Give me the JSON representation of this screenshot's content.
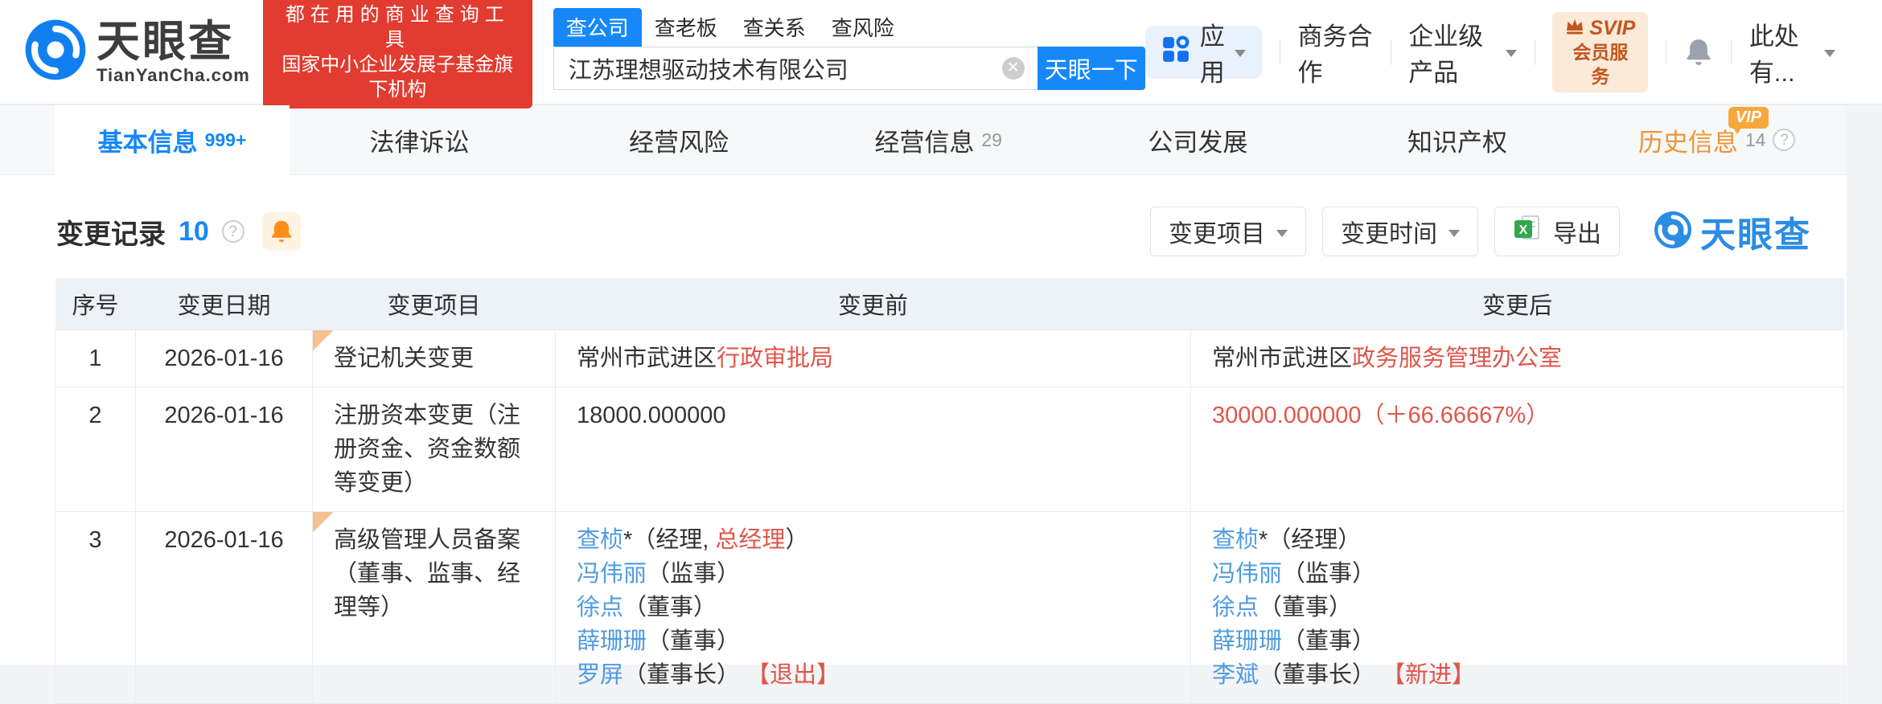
{
  "colors": {
    "blue": "#1688fa",
    "link": "#4f9be0",
    "red": "#e0564a",
    "orange": "#ee9436"
  },
  "brand": {
    "logo_text": "天眼查",
    "logo_domain": "TianYanCha.com",
    "slogan1": "都在用的商业查询工具",
    "slogan2": "国家中小企业发展子基金旗下机构"
  },
  "search": {
    "tabs": [
      {
        "label": "查公司",
        "active": true
      },
      {
        "label": "查老板",
        "active": false
      },
      {
        "label": "查关系",
        "active": false
      },
      {
        "label": "查风险",
        "active": false
      }
    ],
    "value": "江苏理想驱动技术有限公司",
    "button": "天眼一下"
  },
  "nav": {
    "apps": "应用",
    "business": "商务合作",
    "enterprise": "企业级产品",
    "svip_top": "SVIP",
    "svip_bottom": "会员服务",
    "user": "此处有..."
  },
  "page_tabs": [
    {
      "label": "基本信息",
      "count": "999+",
      "active": true,
      "vip": false,
      "help": false
    },
    {
      "label": "法律诉讼",
      "count": "",
      "active": false,
      "vip": false,
      "help": false
    },
    {
      "label": "经营风险",
      "count": "",
      "active": false,
      "vip": false,
      "help": false
    },
    {
      "label": "经营信息",
      "count": "29",
      "active": false,
      "vip": false,
      "help": false
    },
    {
      "label": "公司发展",
      "count": "",
      "active": false,
      "vip": false,
      "help": false
    },
    {
      "label": "知识产权",
      "count": "",
      "active": false,
      "vip": false,
      "help": false
    },
    {
      "label": "历史信息",
      "count": "14",
      "active": false,
      "vip": true,
      "help": true
    }
  ],
  "vip_badge": "VIP",
  "section": {
    "title": "变更记录",
    "count": "10",
    "filter_item": "变更项目",
    "filter_time": "变更时间",
    "export": "导出",
    "watermark": "天眼查"
  },
  "table": {
    "headers": [
      "序号",
      "变更日期",
      "变更项目",
      "变更前",
      "变更后"
    ],
    "rows": [
      {
        "index": "1",
        "date": "2026-01-16",
        "marker": true,
        "item": "登记机关变更",
        "before": [
          [
            {
              "t": "常州市武进区",
              "c": "d"
            },
            {
              "t": "行政审批局",
              "c": "r"
            }
          ]
        ],
        "after": [
          [
            {
              "t": "常州市武进区",
              "c": "d"
            },
            {
              "t": "政务服务管理办公室",
              "c": "r"
            }
          ]
        ]
      },
      {
        "index": "2",
        "date": "2026-01-16",
        "marker": false,
        "item": "注册资本变更（注册资金、资金数额等变更）",
        "before": [
          [
            {
              "t": "18000.000000",
              "c": "d"
            }
          ]
        ],
        "after": [
          [
            {
              "t": "30000.000000（＋66.66667%）",
              "c": "r"
            }
          ]
        ]
      },
      {
        "index": "3",
        "date": "2026-01-16",
        "marker": true,
        "item": "高级管理人员备案（董事、监事、经理等）",
        "before": [
          [
            {
              "t": "查桢",
              "c": "l"
            },
            {
              "t": "*（经理, ",
              "c": "d"
            },
            {
              "t": "总经理",
              "c": "r"
            },
            {
              "t": "）",
              "c": "d"
            }
          ],
          [
            {
              "t": "冯伟丽",
              "c": "l"
            },
            {
              "t": "（监事）",
              "c": "d"
            }
          ],
          [
            {
              "t": "徐点",
              "c": "l"
            },
            {
              "t": "（董事）",
              "c": "d"
            }
          ],
          [
            {
              "t": "薛珊珊",
              "c": "l"
            },
            {
              "t": "（董事）",
              "c": "d"
            }
          ],
          [
            {
              "t": "罗屏",
              "c": "l"
            },
            {
              "t": "（董事长） ",
              "c": "d"
            },
            {
              "t": "【退出】",
              "c": "r"
            }
          ]
        ],
        "after": [
          [
            {
              "t": "查桢",
              "c": "l"
            },
            {
              "t": "*（经理）",
              "c": "d"
            }
          ],
          [
            {
              "t": "冯伟丽",
              "c": "l"
            },
            {
              "t": "（监事）",
              "c": "d"
            }
          ],
          [
            {
              "t": "徐点",
              "c": "l"
            },
            {
              "t": "（董事）",
              "c": "d"
            }
          ],
          [
            {
              "t": "薛珊珊",
              "c": "l"
            },
            {
              "t": "（董事）",
              "c": "d"
            }
          ],
          [
            {
              "t": "李斌",
              "c": "l"
            },
            {
              "t": "（董事长） ",
              "c": "d"
            },
            {
              "t": "【新进】",
              "c": "r"
            }
          ]
        ]
      }
    ]
  }
}
